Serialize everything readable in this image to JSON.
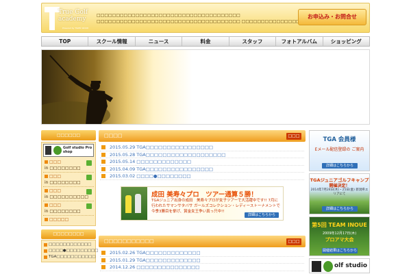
{
  "header": {
    "logo_text": "True Golf academy",
    "logo_subtext": "Powered by TIGER WOOD",
    "description": "□□□□□□□□□□□□□□□□□□□□□□□□□□□□□□□□□□□□□ □□□□□□□□□□□□□□□□□□□□□□□□□□□□□□□□□□□□□ □□□□□□□□□□□□□□□",
    "apply_button": "お申込み・お問合せ"
  },
  "nav": {
    "items": [
      "TOP",
      "スクール情報",
      "ニュース",
      "料金",
      "スタッフ",
      "フォトアルバム",
      "ショッピング"
    ]
  },
  "sidebar": {
    "header": "□□□□□□",
    "proshop_label": "Golf studio Pro shop",
    "items": [
      {
        "label": "□□□",
        "in_text": "in □□□□□□□□"
      },
      {
        "label": "□□□",
        "in_text": "in □□□□□□□□"
      },
      {
        "label": "□□□",
        "in_text": "in □□□□□□□□□□"
      },
      {
        "label": "□□□",
        "in_text": "in □□□□□□□□"
      }
    ],
    "footer_link": "□□□□□",
    "header2": "□□□□□□□□",
    "links": [
      "□□□□□□□□□□□□",
      "□□□□●□□□□□□□□□",
      "TGA□□□□□□□□□□□"
    ]
  },
  "news": {
    "title": "□□□□",
    "more": "□□□",
    "items": [
      {
        "date": "2015.05.29",
        "text": "TGA□□□□□□□□□□□□□□□□"
      },
      {
        "date": "2015.05.28",
        "text": "TGA□□□□□□□□□□□□□□□□□□□"
      },
      {
        "date": "2015.05.14",
        "text": "□□□□□□□□□□□□□"
      },
      {
        "date": "2015.04.09",
        "text": "TGA□□□□□□□□□□□□□□□□"
      },
      {
        "date": "2015.03.02",
        "text": "□□□□●□□□□□□□□"
      }
    ]
  },
  "banner": {
    "headline": "成田 美寿々プロ　ツアー通算５勝！",
    "body": "TGAジュニア出身の成田　美寿々プロが女子ツアーで大活躍中です!! 7月に行われたサマンサタバサ ガールズコレクション・レディーストーナメントで今季3勝目を挙げ、賞金女王争い真っ只中!!",
    "more": "詳細はこちらから"
  },
  "news2": {
    "title": "□□□□□□□□□□□",
    "more": "□□□",
    "items": [
      {
        "date": "2015.02.26",
        "text": "TGA□□□□□□□□□□□□□"
      },
      {
        "date": "2015.01.29",
        "text": "TGA□□□□□□□□□□□□□"
      },
      {
        "date": "2014.12.26",
        "text": "□□□□□□□□□□□□□□□"
      }
    ]
  },
  "ads": {
    "member": {
      "title": "TGA 会員様",
      "text": "Eメール配信登録の ご案内",
      "more": "詳細はこちらから"
    },
    "camp": {
      "title": "TGAジュニアゴルフキャンプ",
      "subtitle": "開催決定！",
      "text": "2014年7月24日(木)・25日(金) 新潟県エリアにて",
      "more": "詳細はこちらから"
    },
    "team": {
      "title": "第5回 TEAM INOUE",
      "date": "2009年12月17日(木)",
      "subtitle": "プロアマ大会",
      "more": "開催結果はこちらから"
    },
    "studio": {
      "label": "olf studio"
    }
  },
  "colors": {
    "accent_orange": "#ef9d1e",
    "header_gold": "#f7d86a",
    "link_blue": "#3a6fb6",
    "button_blue": "#2f6fb8"
  }
}
